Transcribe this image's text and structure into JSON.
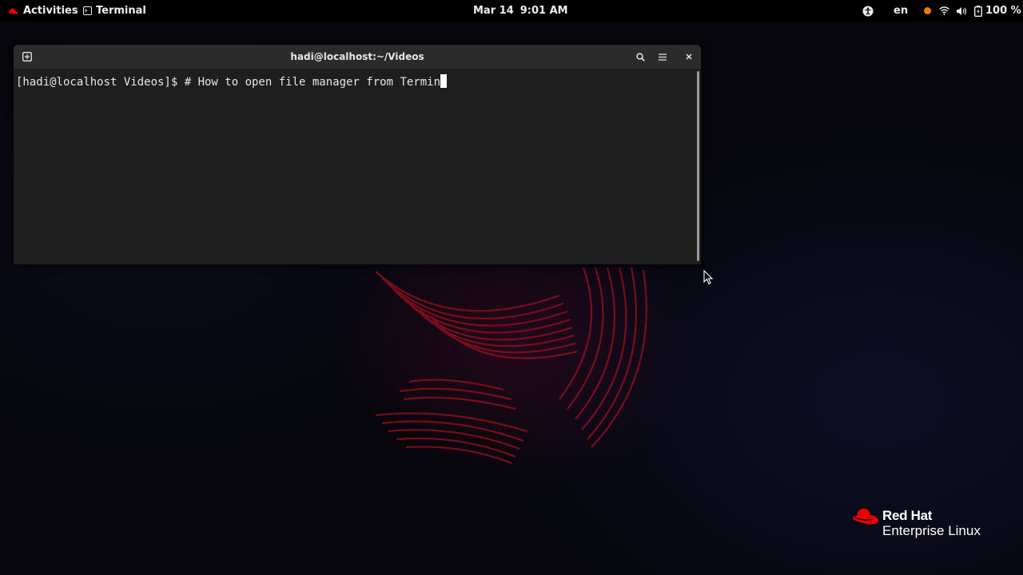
{
  "topbar": {
    "activities_label": "Activities",
    "app_menu_label": "Terminal",
    "clock_date": "Mar 14",
    "clock_time": "9:01 AM",
    "language": "en",
    "battery_label": "100 %",
    "icons": {
      "activities": "redhat-hat-icon",
      "app": "terminal-icon",
      "accessibility": "accessibility-icon",
      "notification": "notification-dot-icon",
      "wifi": "wifi-icon",
      "volume": "volume-icon",
      "battery": "battery-icon"
    },
    "notification_color": "#f57900"
  },
  "terminal": {
    "title": "hadi@localhost:~/Videos",
    "prompt": "[hadi@localhost Videos]$ ",
    "command": "# How to open file manager from Termin",
    "buttons": {
      "new_tab": "new-tab-icon",
      "search": "search-icon",
      "menu": "hamburger-menu-icon",
      "close": "close-icon"
    }
  },
  "branding": {
    "brand": "Red Hat",
    "product": "Enterprise Linux",
    "accent_color": "#ee0000"
  }
}
